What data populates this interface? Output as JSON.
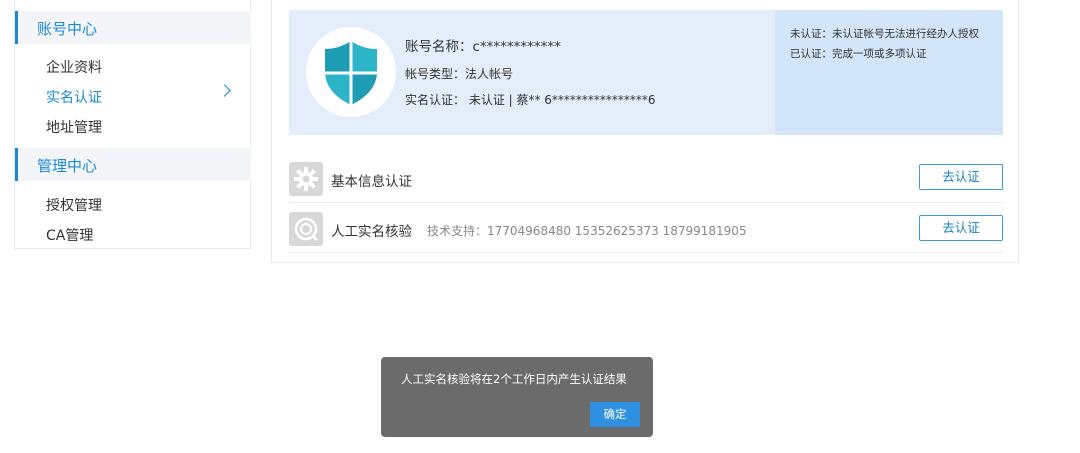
{
  "sidebar": {
    "groups": [
      {
        "title": "账号中心",
        "items": [
          "企业资料",
          "实名认证",
          "地址管理"
        ]
      },
      {
        "title": "管理中心",
        "items": [
          "授权管理",
          "CA管理"
        ]
      }
    ]
  },
  "account": {
    "name_label": "账号名称：c************",
    "type_label": "帐号类型：法人帐号",
    "realname_status": "实名认证：  未认证    |    蔡** 6****************6",
    "note_unverified": "未认证：未认证帐号无法进行经办人授权",
    "note_verified": "已认证：完成一项或多项认证"
  },
  "rows": [
    {
      "title": "基本信息认证",
      "support": "",
      "button": "去认证"
    },
    {
      "title": "人工实名核验",
      "support": "技术支持：17704968480 15352625373 18799181905",
      "button": "去认证"
    }
  ],
  "dialog": {
    "message": "人工实名核验将在2个工作日内产生认证结果",
    "ok_label": "确定"
  },
  "colors": {
    "accent": "#1a8ad8",
    "banner_bg": "#e4eefa",
    "shield_teal": "#2cb5c8",
    "dialog_bg": "#6b6b6b",
    "ok_button": "#2f8fe0"
  },
  "icons": [
    "shield-icon",
    "gear-icon",
    "chevron-right-icon",
    "verify-id-icon"
  ]
}
